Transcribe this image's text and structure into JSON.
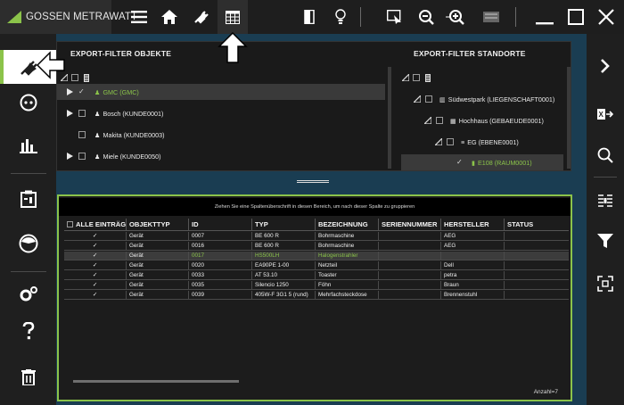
{
  "app": {
    "logo_text": "GOSSEN METRAWATT"
  },
  "colors": {
    "accent": "#8bc34a",
    "background": "#1a3d52",
    "panel": "#1a1a1a"
  },
  "toolbar": {
    "icons": [
      "menu-icon",
      "home-icon",
      "plug-icon",
      "grid-table-icon",
      "door-icon",
      "bulb-icon",
      "select-cursor-icon",
      "zoom-out-icon",
      "zoom-in-icon",
      "keyboard-icon",
      "minimize-icon",
      "maximize-icon",
      "close-icon"
    ]
  },
  "left_sidebar": {
    "icons": [
      "plug-icon",
      "socket-icon",
      "bar-chart-icon",
      "clipboard-icon",
      "gauge-icon",
      "settings-icon",
      "help-icon",
      "trash-icon"
    ],
    "active": "plug-icon"
  },
  "right_sidebar": {
    "icons": [
      "chevron-right-icon",
      "export-icon",
      "search-icon",
      "column-chooser-icon",
      "filter-icon",
      "expand-icon"
    ]
  },
  "export_objects": {
    "title": "EXPORT-FILTER OBJEKTE",
    "items": [
      {
        "label": "GMC (GMC)",
        "expanded": false,
        "checked": true,
        "selected": true
      },
      {
        "label": "Bosch (KUNDE0001)",
        "expanded": false,
        "checked": false,
        "selected": false
      },
      {
        "label": "Makita (KUNDE0003)",
        "expanded": null,
        "checked": false,
        "selected": false
      },
      {
        "label": "Miele (KUNDE0050)",
        "expanded": false,
        "checked": false,
        "selected": false
      }
    ]
  },
  "export_locations": {
    "title": "EXPORT-FILTER STANDORTE",
    "items": [
      {
        "label": "Südwestpark (LIEGENSCHAFT0001)",
        "level": 1
      },
      {
        "label": "Hochhaus (GEBAEUDE0001)",
        "level": 2
      },
      {
        "label": "EG (EBENE0001)",
        "level": 3
      },
      {
        "label": "E108 (RAUM0001)",
        "level": 4,
        "checked": true,
        "selected": true
      }
    ]
  },
  "grid": {
    "group_hint": "Ziehen Sie eine Spaltenüberschrift in diesen Bereich, um nach dieser Spalte zu gruppieren",
    "columns": [
      "ALLE EINTRÄGE",
      "OBJEKTTYP",
      "ID",
      "TYP",
      "BEZEICHNUNG",
      "SERIENNUMMER",
      "HERSTELLER",
      "STATUS"
    ],
    "rows": [
      {
        "objekttyp": "Gerät",
        "id": "0007",
        "typ": "BE 600 R",
        "bezeichnung": "Bohrmaschine",
        "seriennummer": "",
        "hersteller": "AEG",
        "status": "",
        "highlight": false
      },
      {
        "objekttyp": "Gerät",
        "id": "0016",
        "typ": "BE 600 R",
        "bezeichnung": "Bohrmaschine",
        "seriennummer": "",
        "hersteller": "AEG",
        "status": "",
        "highlight": false
      },
      {
        "objekttyp": "Gerät",
        "id": "0017",
        "typ": "HS500LH",
        "bezeichnung": "Halogenstrahler",
        "seriennummer": "",
        "hersteller": "",
        "status": "",
        "highlight": true
      },
      {
        "objekttyp": "Gerät",
        "id": "0020",
        "typ": "EA90PE 1-00",
        "bezeichnung": "Netzteil",
        "seriennummer": "",
        "hersteller": "Dell",
        "status": "",
        "highlight": false
      },
      {
        "objekttyp": "Gerät",
        "id": "0033",
        "typ": "AT 53.10",
        "bezeichnung": "Toaster",
        "seriennummer": "",
        "hersteller": "petra",
        "status": "",
        "highlight": false
      },
      {
        "objekttyp": "Gerät",
        "id": "0035",
        "typ": "Silencio 1250",
        "bezeichnung": "Föhn",
        "seriennummer": "",
        "hersteller": "Braun",
        "status": "",
        "highlight": false
      },
      {
        "objekttyp": "Gerät",
        "id": "0039",
        "typ": "405W-F 3G1 5 (rund)",
        "bezeichnung": "Mehrfachsteckdose",
        "seriennummer": "",
        "hersteller": "Brennenstuhl",
        "status": "",
        "highlight": false
      }
    ],
    "count_label": "Anzahl=7"
  }
}
